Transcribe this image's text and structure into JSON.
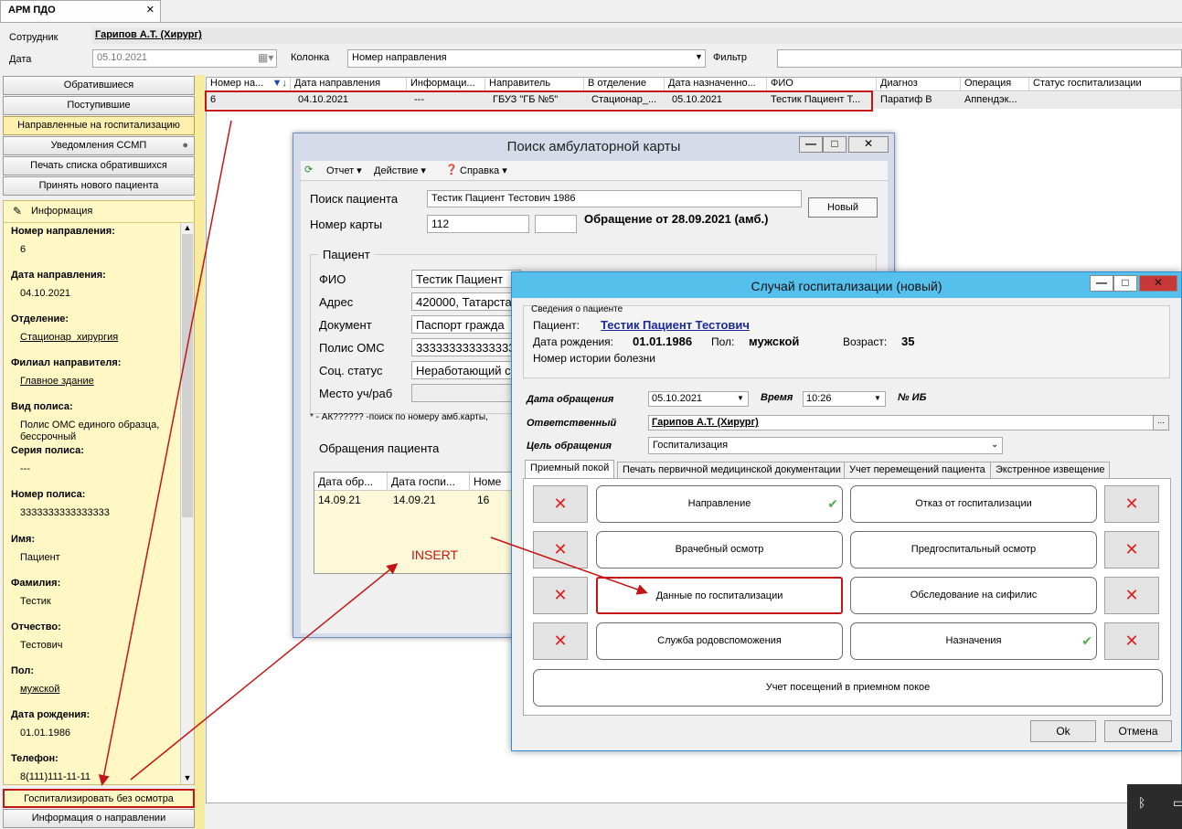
{
  "app_tab": {
    "title": "АРМ ПДО",
    "close": "✕"
  },
  "toolbar": {
    "employee_label": "Сотрудник",
    "employee": "Гарипов А.Т. (Хирург)",
    "date_label": "Дата",
    "date": "05.10.2021",
    "column_label": "Колонка",
    "column": "Номер направления",
    "filter_label": "Фильтр"
  },
  "left_buttons": [
    "Обратившиеся",
    "Поступившие",
    "Направленные на госпитализацию",
    "Уведомления ССМП",
    "Печать списка обратившихся",
    "Принять нового пациента"
  ],
  "info": {
    "header": "Информация",
    "fields": [
      {
        "label": "Номер направления:",
        "value": "6"
      },
      {
        "label": "Дата направления:",
        "value": "04.10.2021"
      },
      {
        "label": "Отделение:",
        "value": "Стационар_хирургия"
      },
      {
        "label": "Филиал направителя:",
        "value": "Главное здание"
      },
      {
        "label": "Вид полиса:",
        "value": "Полис ОМС единого образца, бессрочный"
      },
      {
        "label": "Серия полиса:",
        "value": "---"
      },
      {
        "label": "Номер полиса:",
        "value": "3333333333333333"
      },
      {
        "label": "Имя:",
        "value": "Пациент"
      },
      {
        "label": "Фамилия:",
        "value": "Тестик"
      },
      {
        "label": "Отчество:",
        "value": "Тестович"
      },
      {
        "label": "Пол:",
        "value": "мужской"
      },
      {
        "label": "Дата рождения:",
        "value": "01.01.1986"
      },
      {
        "label": "Телефон:",
        "value": "8(111)111-11-11"
      }
    ]
  },
  "bottom_buttons": [
    "Госпитализировать без осмотра",
    "Информация о направлении"
  ],
  "grid": {
    "headers": [
      "Номер на...",
      "Дата направления",
      "Информаци...",
      "Направитель",
      "В отделение",
      "Дата назначенно...",
      "ФИО",
      "Диагноз",
      "Операция",
      "Статус госпитализации"
    ],
    "row": [
      "6",
      "04.10.2021",
      "---",
      "ГБУЗ \"ГБ №5\"",
      "Стационар_...",
      "05.10.2021",
      "Тестик Пациент Т...",
      "Паратиф В",
      "Аппендэк...",
      ""
    ]
  },
  "win1": {
    "title": "Поиск амбулаторной карты",
    "menu": [
      "Отчет ▾",
      "Действие ▾",
      "Справка ▾"
    ],
    "search_label": "Поиск пациента",
    "search_value": "Тестик Пациент Тестович 1986",
    "new_btn": "Новый",
    "card_label": "Номер карты",
    "card_value": "112",
    "appeal": "Обращение от 28.09.2021 (амб.)",
    "patient_group": "Пациент",
    "patient_fields": [
      {
        "label": "ФИО",
        "value": "Тестик Пациент"
      },
      {
        "label": "Адрес",
        "value": "420000, Татарста"
      },
      {
        "label": "Документ",
        "value": "Паспорт гражда"
      },
      {
        "label": "Полис ОМС",
        "value": "333333333333333"
      },
      {
        "label": "Соц. статус",
        "value": "Неработающий с"
      },
      {
        "label": "Место уч/раб",
        "value": ""
      }
    ],
    "hint": "* - АК?????? -поиск по номеру амб.карты,",
    "appeals_group": "Обращения пациента",
    "appeals_headers": [
      "Дата обр...",
      "Дата госпи...",
      "Номе"
    ],
    "appeals_row": [
      "14.09.21",
      "14.09.21",
      "16"
    ]
  },
  "win2": {
    "title": "Случай госпитализации (новый)",
    "info_group": "Сведения о пациенте",
    "patient_label": "Пациент:",
    "patient": "Тестик Пациент Тестович",
    "dob_label": "Дата рождения:",
    "dob": "01.01.1986",
    "sex_label": "Пол:",
    "sex": "мужской",
    "age_label": "Возраст:",
    "age": "35",
    "history_label": "Номер истории болезни",
    "date_label": "Дата обращения",
    "date": "05.10.2021",
    "time_label": "Время",
    "time": "10:26",
    "ib_label": "№ ИБ",
    "resp_label": "Ответственный",
    "resp": "Гарипов А.Т. (Хирург)",
    "goal_label": "Цель обращения",
    "goal": "Госпитализация",
    "tabs": [
      "Приемный покой",
      "Печать первичной медицинской документации",
      "Учет перемещений пациента",
      "Экстренное извещение"
    ],
    "buttons": [
      "Направление",
      "Отказ от госпитализации",
      "Врачебный осмотр",
      "Предгоспитальный осмотр",
      "Данные по госпитализации",
      "Обследование на сифилис",
      "Служба родовспоможения",
      "Назначения"
    ],
    "wide_button": "Учет посещений в приемном покое",
    "ok": "Ok",
    "cancel": "Отмена"
  },
  "annotation": "INSERT",
  "colors": {
    "accent_red": "#c41616",
    "title_blue": "#55c0ec",
    "info_yellow": "#fff8c4"
  }
}
